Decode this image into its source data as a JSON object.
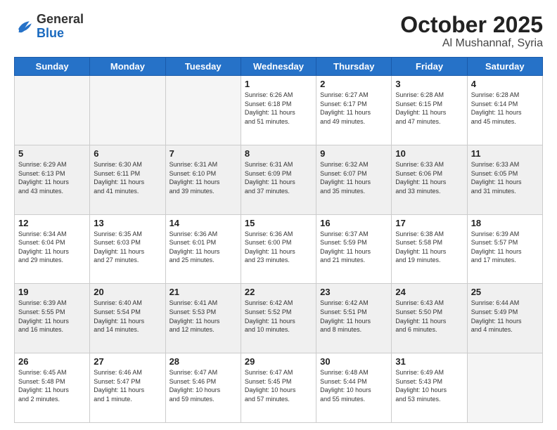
{
  "header": {
    "logo_general": "General",
    "logo_blue": "Blue",
    "title": "October 2025",
    "subtitle": "Al Mushannaf, Syria"
  },
  "days_of_week": [
    "Sunday",
    "Monday",
    "Tuesday",
    "Wednesday",
    "Thursday",
    "Friday",
    "Saturday"
  ],
  "weeks": [
    [
      {
        "day": "",
        "info": "",
        "empty": true
      },
      {
        "day": "",
        "info": "",
        "empty": true
      },
      {
        "day": "",
        "info": "",
        "empty": true
      },
      {
        "day": "1",
        "info": "Sunrise: 6:26 AM\nSunset: 6:18 PM\nDaylight: 11 hours\nand 51 minutes."
      },
      {
        "day": "2",
        "info": "Sunrise: 6:27 AM\nSunset: 6:17 PM\nDaylight: 11 hours\nand 49 minutes."
      },
      {
        "day": "3",
        "info": "Sunrise: 6:28 AM\nSunset: 6:15 PM\nDaylight: 11 hours\nand 47 minutes."
      },
      {
        "day": "4",
        "info": "Sunrise: 6:28 AM\nSunset: 6:14 PM\nDaylight: 11 hours\nand 45 minutes."
      }
    ],
    [
      {
        "day": "5",
        "info": "Sunrise: 6:29 AM\nSunset: 6:13 PM\nDaylight: 11 hours\nand 43 minutes."
      },
      {
        "day": "6",
        "info": "Sunrise: 6:30 AM\nSunset: 6:11 PM\nDaylight: 11 hours\nand 41 minutes."
      },
      {
        "day": "7",
        "info": "Sunrise: 6:31 AM\nSunset: 6:10 PM\nDaylight: 11 hours\nand 39 minutes."
      },
      {
        "day": "8",
        "info": "Sunrise: 6:31 AM\nSunset: 6:09 PM\nDaylight: 11 hours\nand 37 minutes."
      },
      {
        "day": "9",
        "info": "Sunrise: 6:32 AM\nSunset: 6:07 PM\nDaylight: 11 hours\nand 35 minutes."
      },
      {
        "day": "10",
        "info": "Sunrise: 6:33 AM\nSunset: 6:06 PM\nDaylight: 11 hours\nand 33 minutes."
      },
      {
        "day": "11",
        "info": "Sunrise: 6:33 AM\nSunset: 6:05 PM\nDaylight: 11 hours\nand 31 minutes."
      }
    ],
    [
      {
        "day": "12",
        "info": "Sunrise: 6:34 AM\nSunset: 6:04 PM\nDaylight: 11 hours\nand 29 minutes."
      },
      {
        "day": "13",
        "info": "Sunrise: 6:35 AM\nSunset: 6:03 PM\nDaylight: 11 hours\nand 27 minutes."
      },
      {
        "day": "14",
        "info": "Sunrise: 6:36 AM\nSunset: 6:01 PM\nDaylight: 11 hours\nand 25 minutes."
      },
      {
        "day": "15",
        "info": "Sunrise: 6:36 AM\nSunset: 6:00 PM\nDaylight: 11 hours\nand 23 minutes."
      },
      {
        "day": "16",
        "info": "Sunrise: 6:37 AM\nSunset: 5:59 PM\nDaylight: 11 hours\nand 21 minutes."
      },
      {
        "day": "17",
        "info": "Sunrise: 6:38 AM\nSunset: 5:58 PM\nDaylight: 11 hours\nand 19 minutes."
      },
      {
        "day": "18",
        "info": "Sunrise: 6:39 AM\nSunset: 5:57 PM\nDaylight: 11 hours\nand 17 minutes."
      }
    ],
    [
      {
        "day": "19",
        "info": "Sunrise: 6:39 AM\nSunset: 5:55 PM\nDaylight: 11 hours\nand 16 minutes."
      },
      {
        "day": "20",
        "info": "Sunrise: 6:40 AM\nSunset: 5:54 PM\nDaylight: 11 hours\nand 14 minutes."
      },
      {
        "day": "21",
        "info": "Sunrise: 6:41 AM\nSunset: 5:53 PM\nDaylight: 11 hours\nand 12 minutes."
      },
      {
        "day": "22",
        "info": "Sunrise: 6:42 AM\nSunset: 5:52 PM\nDaylight: 11 hours\nand 10 minutes."
      },
      {
        "day": "23",
        "info": "Sunrise: 6:42 AM\nSunset: 5:51 PM\nDaylight: 11 hours\nand 8 minutes."
      },
      {
        "day": "24",
        "info": "Sunrise: 6:43 AM\nSunset: 5:50 PM\nDaylight: 11 hours\nand 6 minutes."
      },
      {
        "day": "25",
        "info": "Sunrise: 6:44 AM\nSunset: 5:49 PM\nDaylight: 11 hours\nand 4 minutes."
      }
    ],
    [
      {
        "day": "26",
        "info": "Sunrise: 6:45 AM\nSunset: 5:48 PM\nDaylight: 11 hours\nand 2 minutes."
      },
      {
        "day": "27",
        "info": "Sunrise: 6:46 AM\nSunset: 5:47 PM\nDaylight: 11 hours\nand 1 minute."
      },
      {
        "day": "28",
        "info": "Sunrise: 6:47 AM\nSunset: 5:46 PM\nDaylight: 10 hours\nand 59 minutes."
      },
      {
        "day": "29",
        "info": "Sunrise: 6:47 AM\nSunset: 5:45 PM\nDaylight: 10 hours\nand 57 minutes."
      },
      {
        "day": "30",
        "info": "Sunrise: 6:48 AM\nSunset: 5:44 PM\nDaylight: 10 hours\nand 55 minutes."
      },
      {
        "day": "31",
        "info": "Sunrise: 6:49 AM\nSunset: 5:43 PM\nDaylight: 10 hours\nand 53 minutes."
      },
      {
        "day": "",
        "info": "",
        "empty": true
      }
    ]
  ]
}
